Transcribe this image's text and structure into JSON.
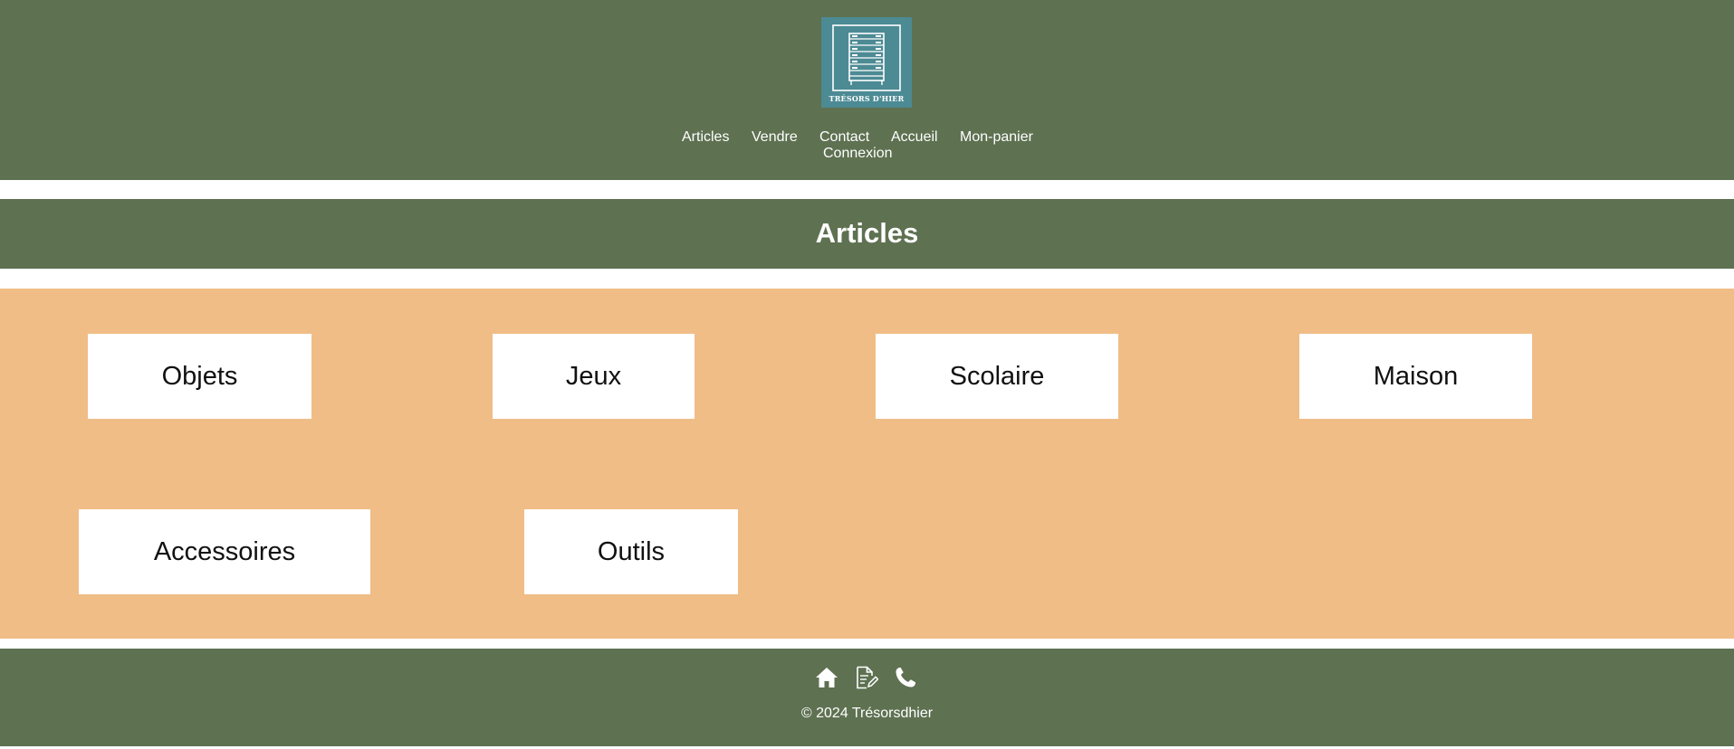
{
  "header": {
    "logo_text": "TRÉSORS D'HIER",
    "nav": {
      "articles": "Articles",
      "vendre": "Vendre",
      "contact": "Contact",
      "accueil": "Accueil",
      "panier": "Mon-panier",
      "connexion": "Connexion"
    }
  },
  "main": {
    "title": "Articles",
    "categories": [
      "Objets",
      "Jeux",
      "Scolaire",
      "Maison",
      "Accessoires",
      "Outils"
    ]
  },
  "footer": {
    "icons": [
      "home-icon",
      "document-edit-icon",
      "phone-icon"
    ],
    "copyright": "© 2024 Trésorsdhier"
  },
  "colors": {
    "header_green": "#5e7151",
    "panel_orange": "#f0bd87",
    "logo_teal": "#4c8a94",
    "card_white": "#ffffff"
  }
}
